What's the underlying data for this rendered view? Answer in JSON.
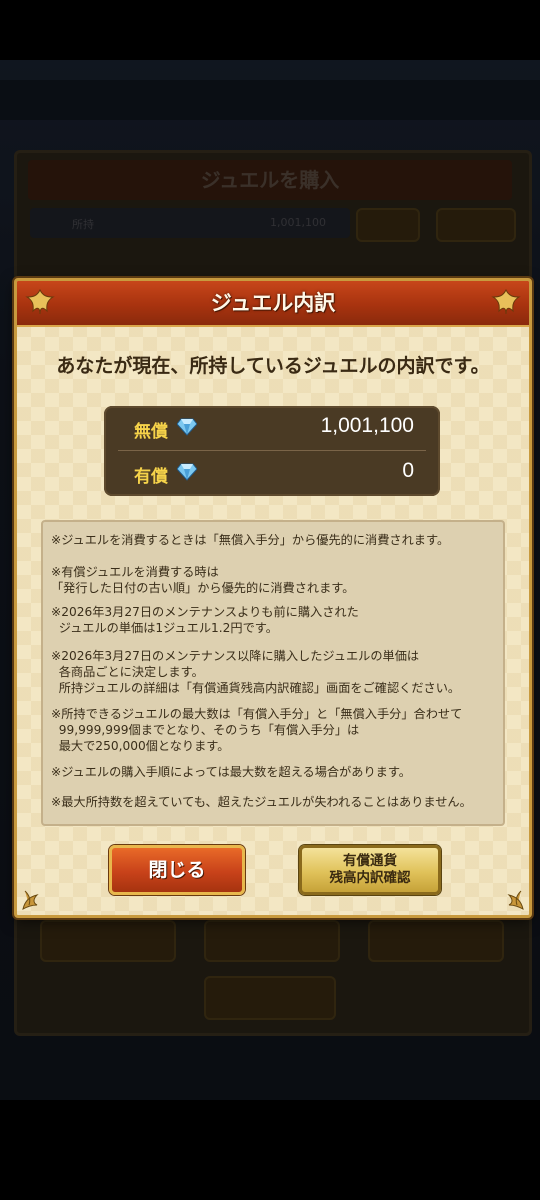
{
  "background": {
    "panel_title": "ジュエルを購入",
    "jewel_bar_label": "所持",
    "jewel_bar_value": "1,001,100"
  },
  "dialog": {
    "title": "ジュエル内訳",
    "intro": "あなたが現在、所持しているジュエルの内訳です。",
    "free_label": "無償",
    "free_value": "1,001,100",
    "paid_label": "有償",
    "paid_value": "0",
    "notes": [
      "※ジュエルを消費するときは「無償入手分」から優先的に消費されます。",
      "※有償ジュエルを消費する時は\n「発行した日付の古い順」から優先的に消費されます。",
      "※2026年3月27日のメンテナンスよりも前に購入された\n  ジュエルの単価は1ジュエル1.2円です。",
      "※2026年3月27日のメンテナンス以降に購入したジュエルの単価は\n  各商品ごとに決定します。\n  所持ジュエルの詳細は「有償通貨残高内訳確認」画面をご確認ください。",
      "※所持できるジュエルの最大数は「有償入手分」と「無償入手分」合わせて\n  99,999,999個までとなり、そのうち「有償入手分」は\n  最大で250,000個となります。",
      "※ジュエルの購入手順によっては最大数を超える場合があります。",
      "※最大所持数を超えていても、超えたジュエルが失われることはありません。"
    ],
    "close_button": "閉じる",
    "confirm_button_line1": "有償通貨",
    "confirm_button_line2": "残高内訳確認"
  },
  "colors": {
    "title_bar": "#a8330f",
    "dialog_bg": "#f3e7c4",
    "label_yellow": "#f6d34a",
    "gem_blue": "#7cc8f0"
  },
  "icons": [
    "diamond-gem-icon",
    "fleur-ornament-icon"
  ]
}
